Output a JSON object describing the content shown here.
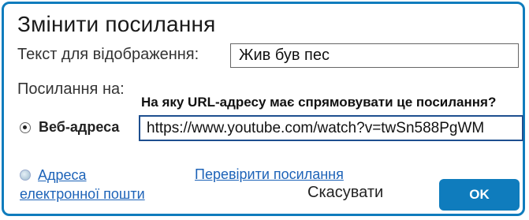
{
  "dialog": {
    "title": "Змінити посилання",
    "display_text_label": "Текст для відображення:",
    "display_text_value": "Жив був пес",
    "link_to_label": "Посилання на:",
    "url_question": "На яку URL-адресу має спрямовувати це посилання?",
    "options": {
      "web_address_label": "Веб-адреса",
      "web_address_selected": true,
      "email_label_line1": "Адреса",
      "email_label_line2": "електронної пошти",
      "email_selected": false
    },
    "url_value": "https://www.youtube.com/watch?v=twSn588PgWM",
    "test_link_label": "Перевірити посилання",
    "cancel_label": "Скасувати",
    "ok_label": "OK"
  },
  "colors": {
    "accent": "#0f7cbd",
    "link": "#1d63b8",
    "url_field_border": "#1e4f8f"
  },
  "icons": {
    "web_radio": "radio-selected-icon",
    "email_radio": "radio-unselected-icon"
  }
}
